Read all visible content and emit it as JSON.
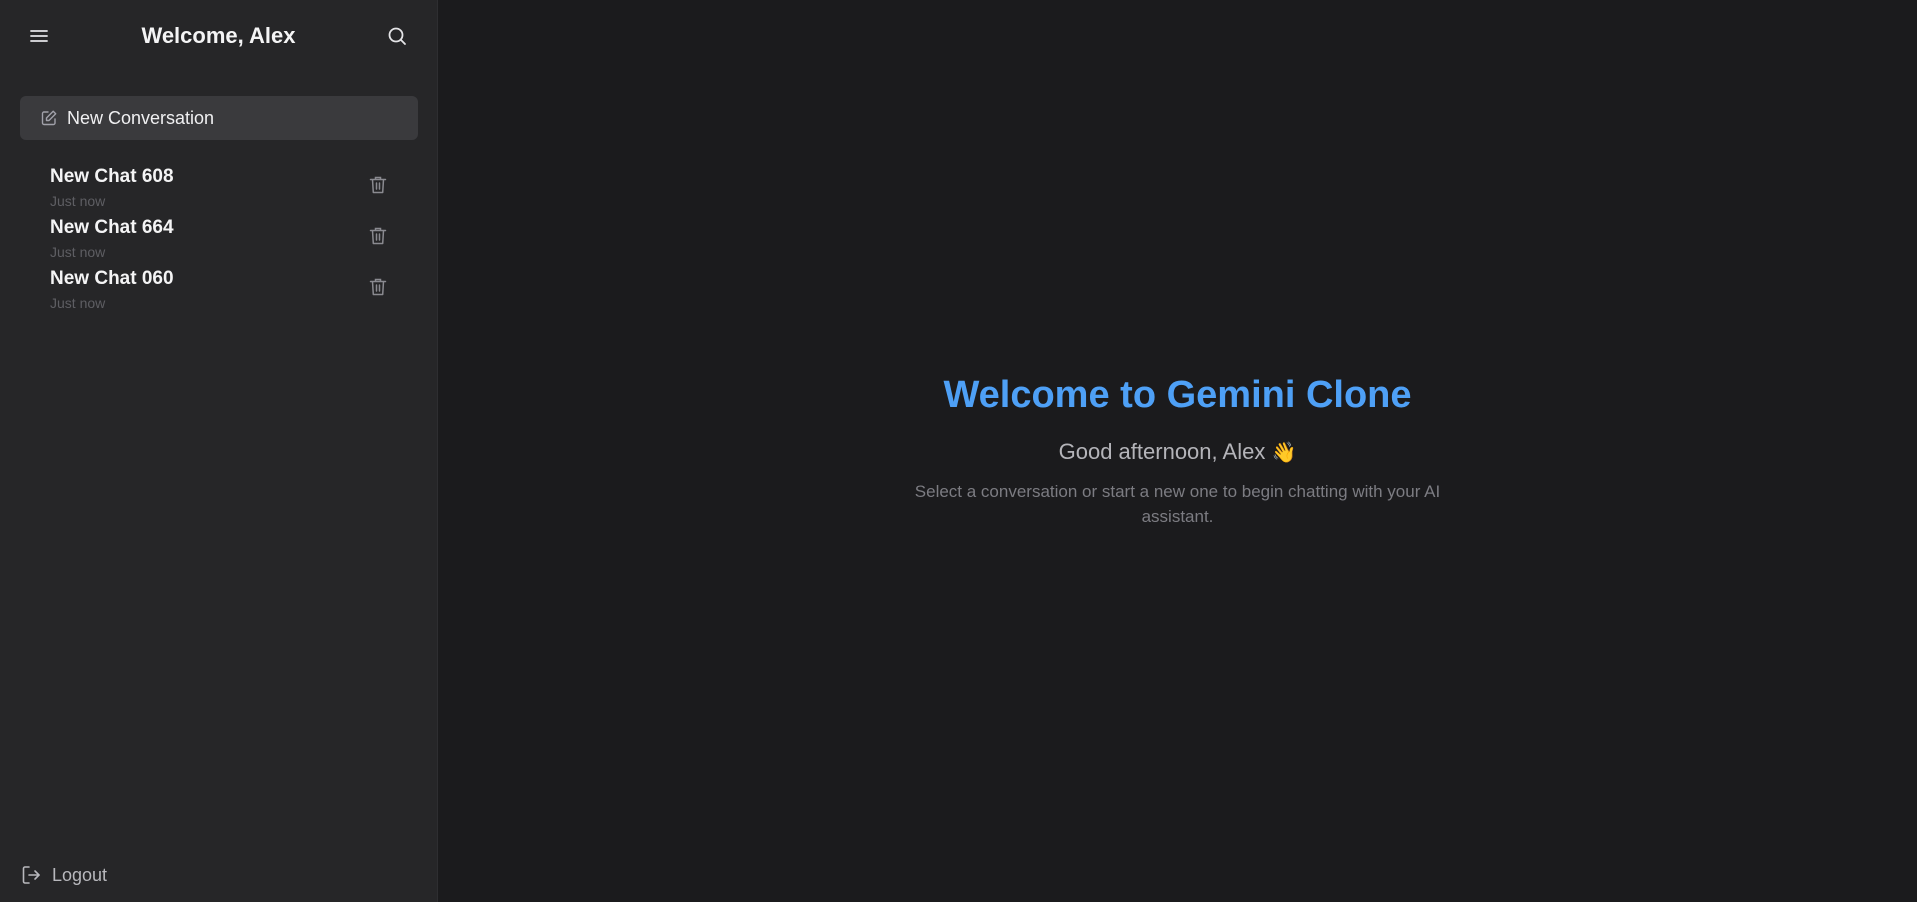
{
  "sidebar": {
    "title": "Welcome, Alex",
    "new_conversation_label": "New Conversation",
    "chats": [
      {
        "title": "New Chat 608",
        "time": "Just now"
      },
      {
        "title": "New Chat 664",
        "time": "Just now"
      },
      {
        "title": "New Chat 060",
        "time": "Just now"
      }
    ],
    "logout_label": "Logout"
  },
  "main": {
    "heading": "Welcome to Gemini Clone",
    "greeting": "Good afternoon, Alex",
    "greeting_emoji": "👋",
    "description": "Select a conversation or start a new one to begin chatting with your AI assistant."
  },
  "icons": {
    "menu": "menu-icon",
    "search": "search-icon",
    "edit": "edit-icon",
    "trash": "trash-icon",
    "logout": "logout-icon"
  },
  "colors": {
    "accent": "#4ea0f6",
    "sidebar_bg": "#262628",
    "main_bg": "#1b1b1d",
    "new_button_bg": "#3a3a3d"
  }
}
